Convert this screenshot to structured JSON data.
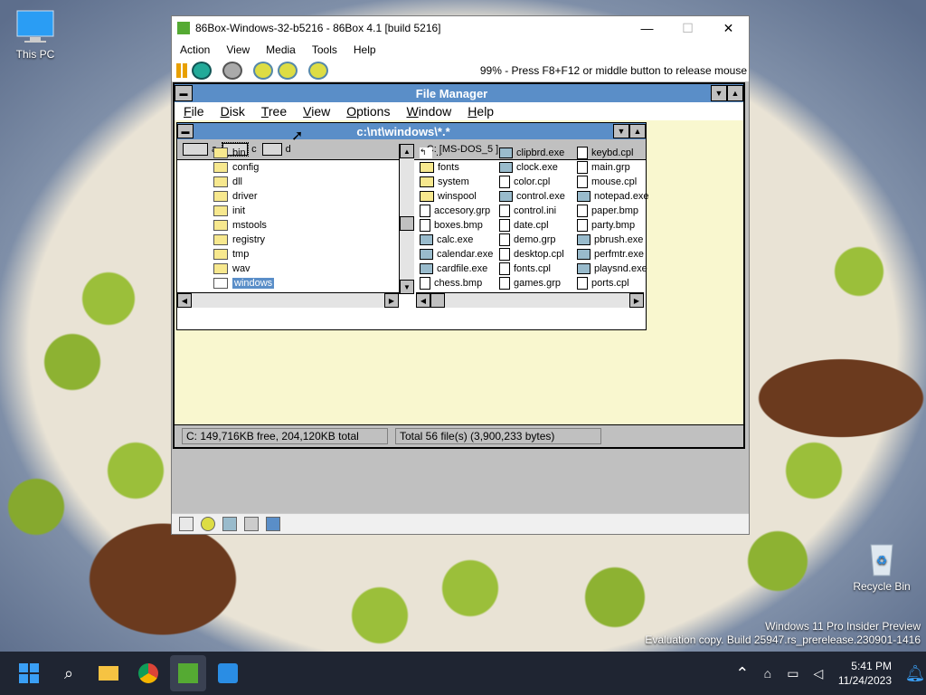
{
  "desktop": {
    "icons": [
      "This PC",
      "Recycle Bin"
    ],
    "watermark": {
      "line1": "Windows 11 Pro Insider Preview",
      "line2": "Evaluation copy. Build 25947.rs_prerelease.230901-1416"
    }
  },
  "host": {
    "title": "86Box-Windows-32-b5216 - 86Box 4.1 [build 5216]",
    "menu": [
      "Action",
      "View",
      "Media",
      "Tools",
      "Help"
    ],
    "status": "99% - Press F8+F12 or middle button to release mouse"
  },
  "file_manager": {
    "title": "File Manager",
    "menu": [
      "File",
      "Disk",
      "Tree",
      "View",
      "Options",
      "Window",
      "Help"
    ],
    "dir_window_title": "c:\\nt\\windows\\*.*",
    "drives": [
      "a",
      "c",
      "d"
    ],
    "volume_label": "C: [MS-DOS_5  ]",
    "tree": [
      "bin",
      "config",
      "dll",
      "driver",
      "init",
      "mstools",
      "registry",
      "tmp",
      "wav",
      "windows"
    ],
    "files_col1": [
      "..",
      "fonts",
      "system",
      "winspool",
      "accesory.grp",
      "boxes.bmp",
      "calc.exe",
      "calendar.exe",
      "cardfile.exe",
      "chess.bmp"
    ],
    "files_col2": [
      "clipbrd.exe",
      "clock.exe",
      "color.cpl",
      "control.exe",
      "control.ini",
      "date.cpl",
      "demo.grp",
      "desktop.cpl",
      "fonts.cpl",
      "games.grp"
    ],
    "files_col3": [
      "keybd.cpl",
      "main.grp",
      "mouse.cpl",
      "notepad.exe",
      "paper.bmp",
      "party.bmp",
      "pbrush.exe",
      "perfmtr.exe",
      "playsnd.exe",
      "ports.cpl"
    ],
    "status_free": "C: 149,716KB free,  204,120KB total",
    "status_total": "Total 56 file(s) (3,900,233 bytes)"
  },
  "taskbar": {
    "time": "5:41 PM",
    "date": "11/24/2023"
  }
}
